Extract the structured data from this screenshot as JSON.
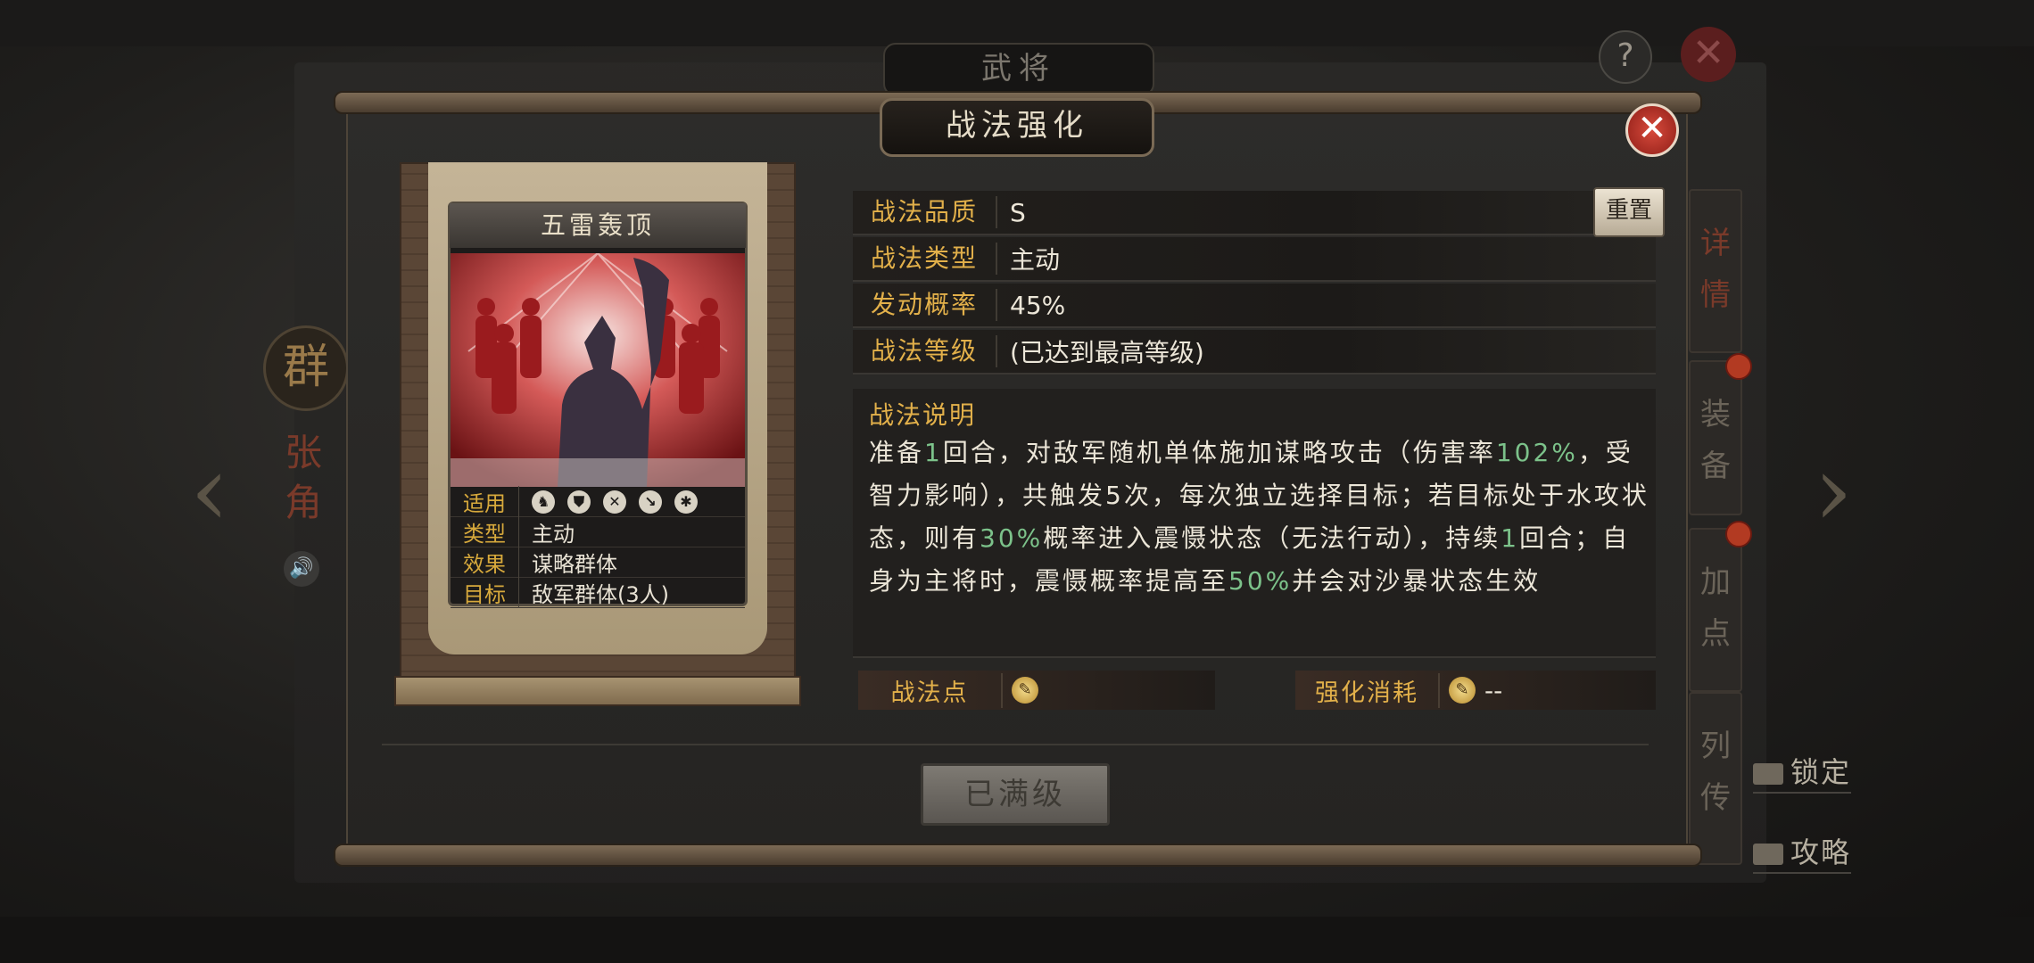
{
  "background": {
    "screen_title": "武将",
    "help_label": "?",
    "close_label": "✕",
    "faction": "群",
    "hero_name": "张角",
    "side_tabs": [
      "详情",
      "装备",
      "加点",
      "列传"
    ],
    "side_links": [
      "锁定",
      "攻略"
    ]
  },
  "modal": {
    "title": "战法强化",
    "close_label": "✕"
  },
  "card": {
    "name": "五雷轰顶",
    "stats": [
      {
        "key": "适用",
        "value": ""
      },
      {
        "key": "类型",
        "value": "主动"
      },
      {
        "key": "效果",
        "value": "谋略群体"
      },
      {
        "key": "目标",
        "value": "敌军群体(3人)"
      }
    ],
    "troop_icons": [
      "cavalry-icon",
      "shield-icon",
      "bow-icon",
      "spear-icon",
      "wheel-icon"
    ]
  },
  "info": {
    "quality_label": "战法品质",
    "quality_value": "S",
    "type_label": "战法类型",
    "type_value": "主动",
    "rate_label": "发动概率",
    "rate_value": "45%",
    "level_label": "战法等级",
    "level_value": "(已达到最高等级)",
    "reset_label": "重置"
  },
  "description": {
    "title": "战法说明",
    "segments": [
      {
        "text": "准备",
        "hl": false
      },
      {
        "text": "1",
        "hl": true
      },
      {
        "text": "回合，对敌军随机单体施加谋略攻击（伤害率",
        "hl": false
      },
      {
        "text": "102%",
        "hl": true
      },
      {
        "text": "，受智力影响），共触发5次，每次独立选择目标；若目标处于水攻状态，则有",
        "hl": false
      },
      {
        "text": "30%",
        "hl": true
      },
      {
        "text": "概率进入震慑状态（无法行动），持续",
        "hl": false
      },
      {
        "text": "1",
        "hl": true
      },
      {
        "text": "回合；自身为主将时，震慑概率提高至",
        "hl": false
      },
      {
        "text": "50%",
        "hl": true
      },
      {
        "text": "并会对沙暴状态生效",
        "hl": false
      }
    ]
  },
  "points": {
    "points_label": "战法点",
    "points_value": "",
    "cost_label": "强化消耗",
    "cost_value": "--"
  },
  "action": {
    "button_label": "已满级"
  },
  "colors": {
    "accent_gold": "#e2b04a",
    "highlight_green": "#7cc28a",
    "close_red": "#c0362c"
  }
}
